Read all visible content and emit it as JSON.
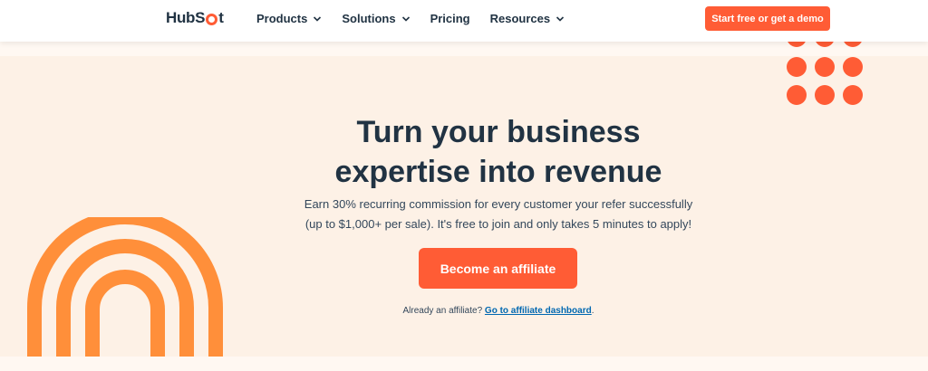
{
  "header": {
    "logo_text_left": "HubS",
    "logo_text_right": "t",
    "nav": [
      {
        "label": "Products",
        "has_dropdown": true
      },
      {
        "label": "Solutions",
        "has_dropdown": true
      },
      {
        "label": "Pricing",
        "has_dropdown": false
      },
      {
        "label": "Resources",
        "has_dropdown": true
      }
    ],
    "cta_label": "Start free or get a demo"
  },
  "hero": {
    "title_line1": "Turn your business",
    "title_line2": "expertise into revenue",
    "subtitle_line1": "Earn 30% recurring commission for every customer your refer successfully",
    "subtitle_line2": "(up to $1,000+ per sale). It's free to join and only takes 5 minutes to apply!",
    "cta_label": "Become an affiliate",
    "already_text": "Already an affiliate?",
    "dashboard_link": "Go to affiliate dashboard",
    "period": "."
  },
  "colors": {
    "accent": "#ff5c35",
    "background": "#fdf1e6",
    "heading": "#213343",
    "arch": "#ff8f3a",
    "link": "#0068b1"
  },
  "icons": {
    "chevron": "chevron-down-icon"
  }
}
